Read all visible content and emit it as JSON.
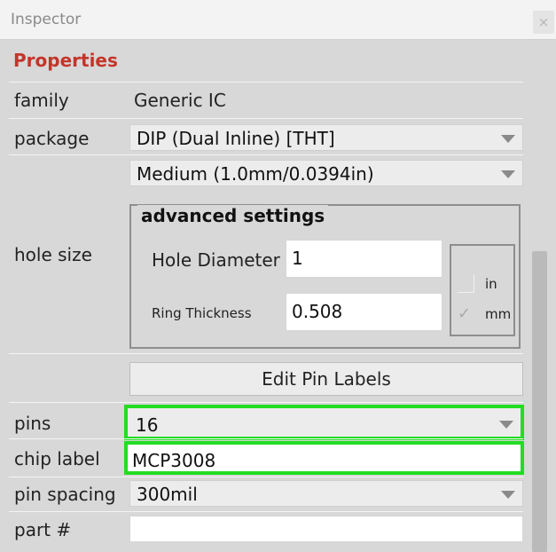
{
  "window": {
    "title": "Inspector",
    "close_glyph": "×"
  },
  "properties": {
    "heading": "Properties",
    "family": {
      "label": "family",
      "value": "Generic IC"
    },
    "package": {
      "label": "package",
      "value": "DIP (Dual Inline) [THT]"
    },
    "hole_size": {
      "label": "hole size",
      "preset": "Medium (1.0mm/0.0394in)",
      "advanced_title": "advanced settings",
      "hole_diameter_label": "Hole Diameter",
      "hole_diameter_value": "1",
      "ring_thickness_label": "Ring Thickness",
      "ring_thickness_value": "0.508",
      "units": [
        {
          "label": "in",
          "checked": false
        },
        {
          "label": "mm",
          "checked": true
        }
      ]
    },
    "edit_pin_labels_button": "Edit Pin Labels",
    "pins": {
      "label": "pins",
      "value": "16"
    },
    "chip_label": {
      "label": "chip label",
      "value": "MCP3008"
    },
    "pin_spacing": {
      "label": "pin spacing",
      "value": "300mil"
    },
    "part_number": {
      "label": "part #",
      "value": ""
    }
  },
  "colors": {
    "heading": "#c4352a",
    "highlight": "#22dd22"
  },
  "icons": {
    "dropdown": "chevron-down-icon",
    "check": "check-icon"
  }
}
